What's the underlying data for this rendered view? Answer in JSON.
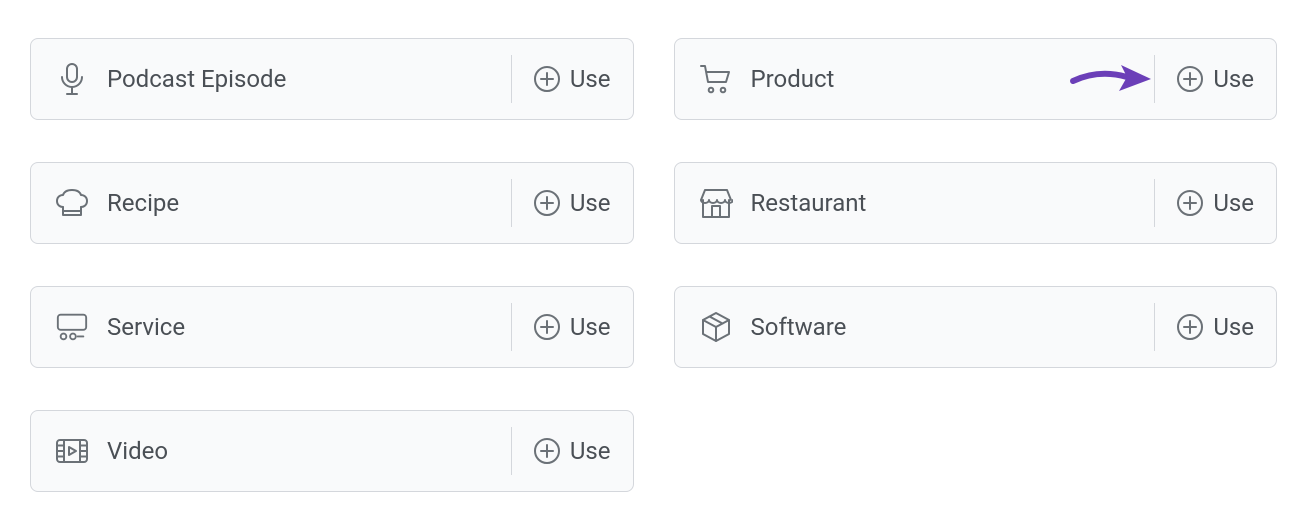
{
  "use_label": "Use",
  "arrow_color": "#6b3fb8",
  "cards": [
    {
      "id": "podcast-episode",
      "label": "Podcast Episode",
      "icon": "microphone-icon",
      "highlight": false
    },
    {
      "id": "product",
      "label": "Product",
      "icon": "shopping-cart-icon",
      "highlight": true
    },
    {
      "id": "recipe",
      "label": "Recipe",
      "icon": "chef-hat-icon",
      "highlight": false
    },
    {
      "id": "restaurant",
      "label": "Restaurant",
      "icon": "storefront-icon",
      "highlight": false
    },
    {
      "id": "service",
      "label": "Service",
      "icon": "service-icon",
      "highlight": false
    },
    {
      "id": "software",
      "label": "Software",
      "icon": "package-icon",
      "highlight": false
    },
    {
      "id": "video",
      "label": "Video",
      "icon": "video-icon",
      "highlight": false
    }
  ]
}
